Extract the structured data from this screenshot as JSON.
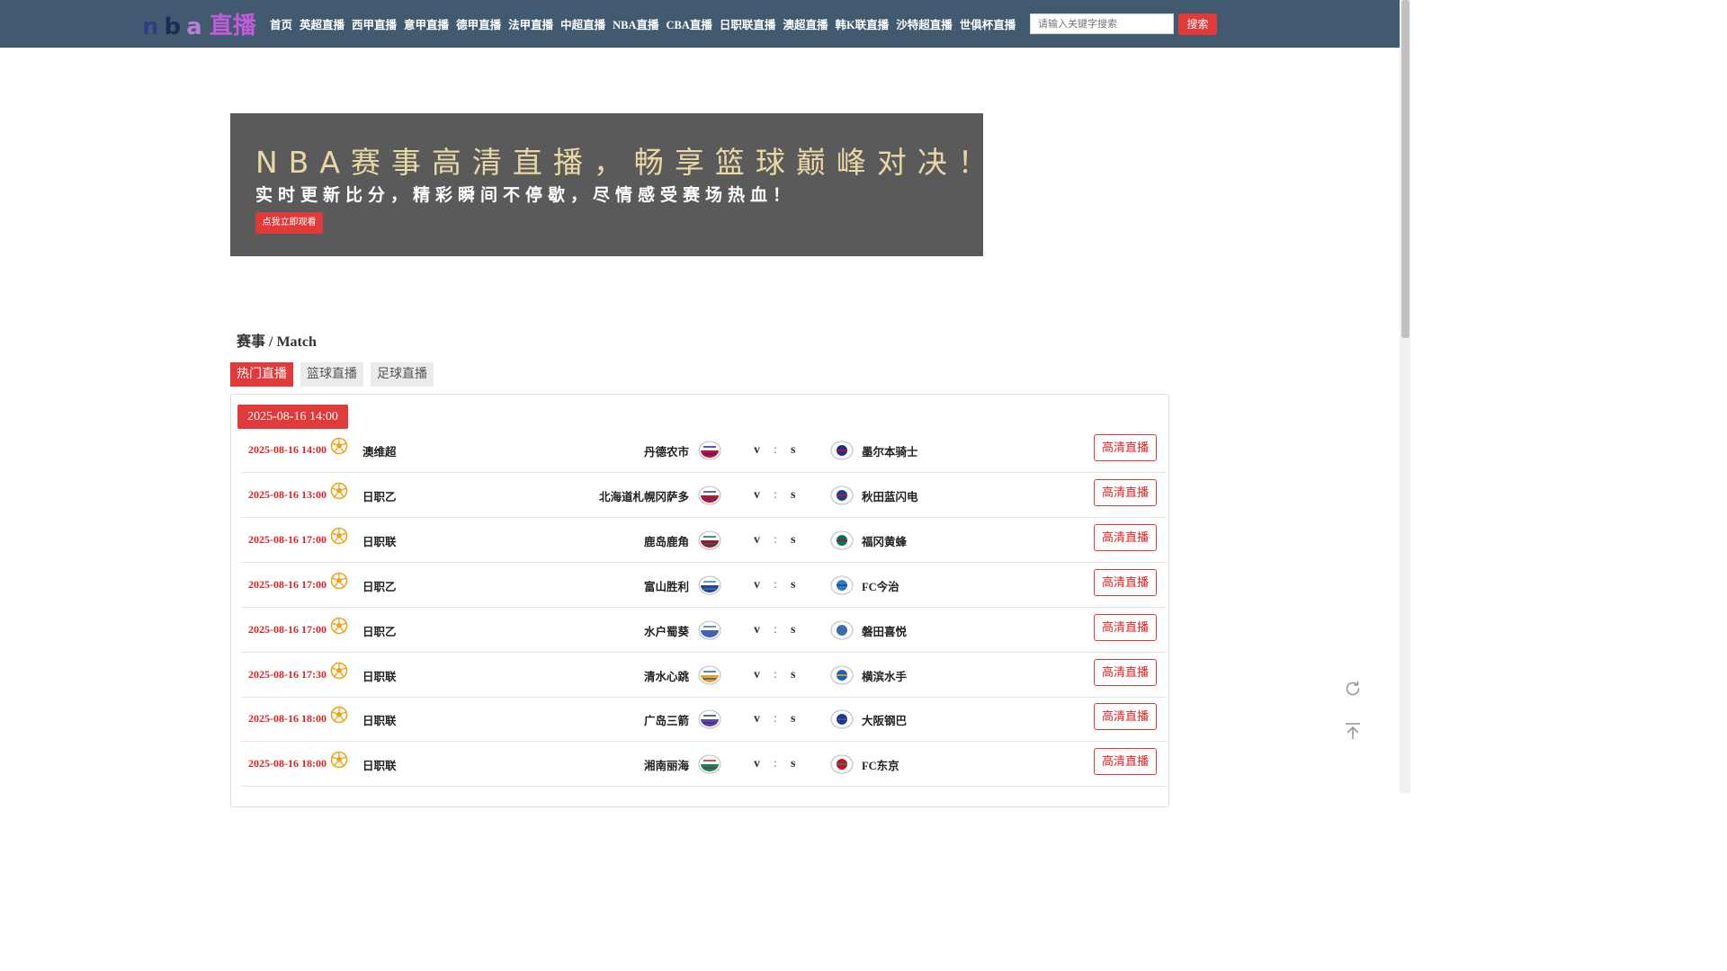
{
  "header": {
    "logo": {
      "c1": "n",
      "c2": "b",
      "c3": "a",
      "c4": "直播"
    },
    "nav": [
      "首页",
      "英超直播",
      "西甲直播",
      "意甲直播",
      "德甲直播",
      "法甲直播",
      "中超直播",
      "NBA直播",
      "CBA直播",
      "日职联直播",
      "澳超直播",
      "韩K联直播",
      "沙特超直播",
      "世俱杯直播"
    ],
    "search_placeholder": "请输入关键字搜索",
    "search_button": "搜索"
  },
  "banner": {
    "title": "NBA赛事高清直播，畅享篮球巅峰对决！",
    "subtitle": "实时更新比分，精彩瞬间不停歇，尽情感受赛场热血！",
    "cta": "点我立即观看"
  },
  "section": {
    "title": "赛事 / Match",
    "tabs": [
      "热门直播",
      "篮球直播",
      "足球直播"
    ],
    "active_tab": 0,
    "date_chip": "2025-08-16 14:00"
  },
  "score": {
    "v": "v",
    "colon": ":",
    "s": "s"
  },
  "matches": [
    {
      "time": "2025-08-16 14:00",
      "league": "澳维超",
      "home": "丹德农市",
      "away": "墨尔本骑士",
      "live": "高清直播",
      "home_icon": "dandenong-logo",
      "away_icon": "melbourne-knights-logo"
    },
    {
      "time": "2025-08-16 13:00",
      "league": "日职乙",
      "home": "北海道札幌冈萨多",
      "away": "秋田蓝闪电",
      "live": "高清直播",
      "home_icon": "sapporo-logo",
      "away_icon": "akita-logo"
    },
    {
      "time": "2025-08-16 17:00",
      "league": "日职联",
      "home": "鹿岛鹿角",
      "away": "福冈黄蜂",
      "live": "高清直播",
      "home_icon": "kashima-logo",
      "away_icon": "fukuoka-logo"
    },
    {
      "time": "2025-08-16 17:00",
      "league": "日职乙",
      "home": "富山胜利",
      "away": "FC今治",
      "live": "高清直播",
      "home_icon": "toyama-logo",
      "away_icon": "imabari-logo"
    },
    {
      "time": "2025-08-16 17:00",
      "league": "日职乙",
      "home": "水户蜀葵",
      "away": "磐田喜悦",
      "live": "高清直播",
      "home_icon": "mito-logo",
      "away_icon": "iwata-logo"
    },
    {
      "time": "2025-08-16 17:30",
      "league": "日职联",
      "home": "清水心跳",
      "away": "横滨水手",
      "live": "高清直播",
      "home_icon": "shimizu-logo",
      "away_icon": "yokohama-logo"
    },
    {
      "time": "2025-08-16 18:00",
      "league": "日职联",
      "home": "广岛三箭",
      "away": "大阪钢巴",
      "live": "高清直播",
      "home_icon": "hiroshima-logo",
      "away_icon": "gamba-osaka-logo"
    },
    {
      "time": "2025-08-16 18:00",
      "league": "日职联",
      "home": "湘南丽海",
      "away": "FC东京",
      "live": "高清直播",
      "home_icon": "shonan-logo",
      "away_icon": "fc-tokyo-logo"
    }
  ],
  "colors": {
    "header_bg": "#415a70",
    "accent_red": "#e23a3a",
    "banner_bg": "#5a5a5a",
    "banner_title": "#e9d7a6"
  }
}
